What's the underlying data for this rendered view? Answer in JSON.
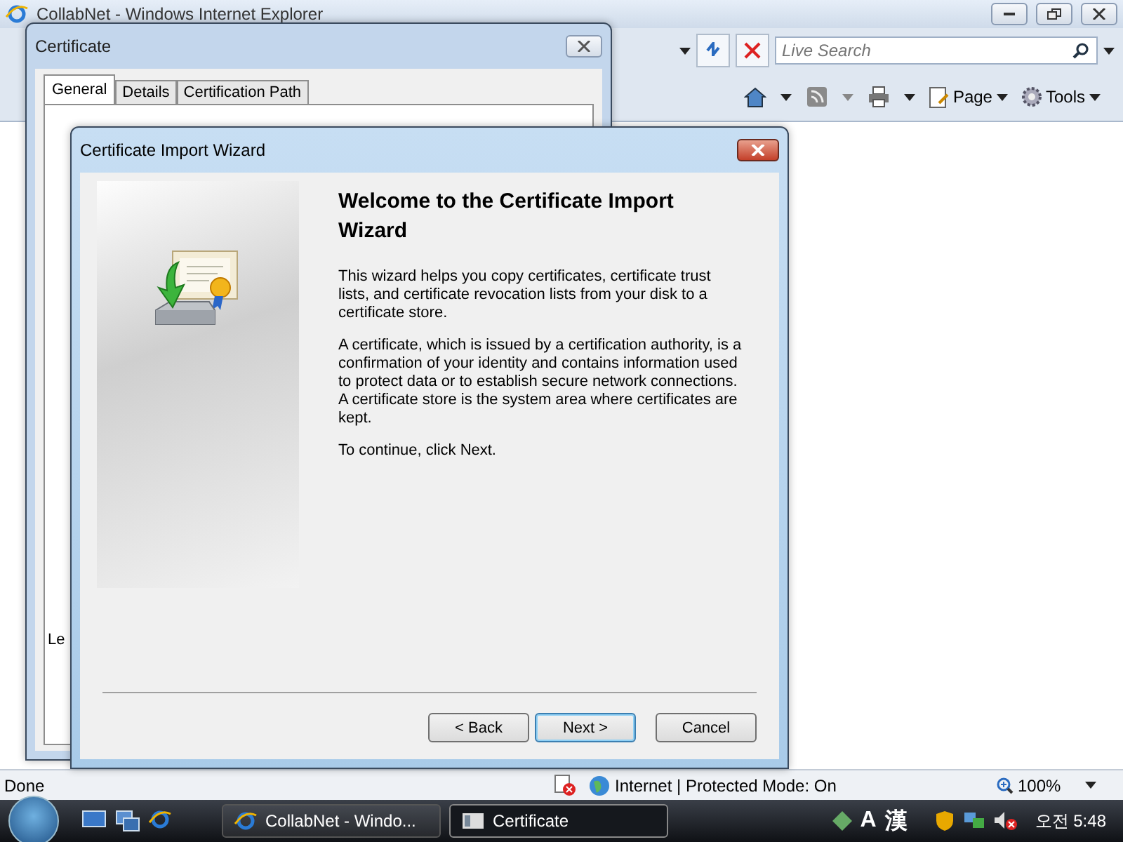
{
  "browser": {
    "title": "CollabNet - Windows Internet Explorer",
    "search": {
      "placeholder": "Live Search"
    },
    "commands": [
      {
        "label": "Page"
      },
      {
        "label": "Tools"
      }
    ],
    "status": {
      "text": "Done",
      "zone": "Internet | Protected Mode: On",
      "zoom": "100%"
    }
  },
  "certificate_dialog": {
    "title": "Certificate",
    "tabs": [
      {
        "label": "General",
        "selected": true
      },
      {
        "label": "Details",
        "selected": false
      },
      {
        "label": "Certification Path",
        "selected": false
      }
    ],
    "fragment": "Le"
  },
  "wizard": {
    "title": "Certificate Import Wizard",
    "heading": "Welcome to the Certificate Import Wizard",
    "paragraphs": [
      "This wizard helps you copy certificates, certificate trust lists, and certificate revocation lists from your disk to a certificate store.",
      "A certificate, which is issued by a certification authority, is a confirmation of your identity and contains information used to protect data or to establish secure network connections. A certificate store is the system area where certificates are kept.",
      "To continue, click Next."
    ],
    "buttons": [
      {
        "label": "< Back",
        "default": false
      },
      {
        "label": "Next >",
        "default": true
      },
      {
        "label": "Cancel",
        "default": false
      }
    ]
  },
  "taskbar": {
    "tasks": [
      {
        "label": "CollabNet - Windo...",
        "selected": false
      },
      {
        "label": "Certificate",
        "selected": true
      }
    ],
    "ime": [
      "A",
      "漢"
    ],
    "clock": "오전 5:48"
  }
}
